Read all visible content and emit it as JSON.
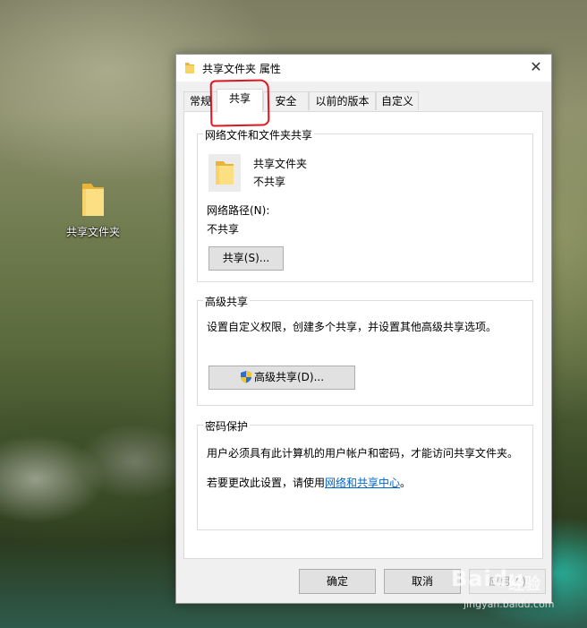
{
  "desktop": {
    "icon_label": "共享文件夹"
  },
  "dialog": {
    "title": "共享文件夹 属性",
    "close_glyph": "✕",
    "tabs": [
      {
        "label": "常规",
        "active": false
      },
      {
        "label": "共享",
        "active": true
      },
      {
        "label": "安全",
        "active": false
      },
      {
        "label": "以前的版本",
        "active": false
      },
      {
        "label": "自定义",
        "active": false
      }
    ],
    "network_share": {
      "group_title": "网络文件和文件夹共享",
      "folder_name": "共享文件夹",
      "share_status": "不共享",
      "path_label": "网络路径(N):",
      "path_value": "不共享",
      "share_button": "共享(S)..."
    },
    "advanced_share": {
      "group_title": "高级共享",
      "description": "设置自定义权限，创建多个共享，并设置其他高级共享选项。",
      "button": "高级共享(D)..."
    },
    "password_protect": {
      "group_title": "密码保护",
      "description": "用户必须具有此计算机的用户帐户和密码，才能访问共享文件夹。",
      "change_prefix": "若要更改此设置，请使用",
      "change_link": "网络和共享中心",
      "change_suffix": "。"
    },
    "footer": {
      "ok": "确定",
      "cancel": "取消",
      "apply": "应用(A)"
    }
  },
  "watermark": {
    "brand": "Baidu",
    "sub": "经验",
    "url": "jingyan.baidu.com"
  },
  "colors": {
    "annotation_red": "#e3141e",
    "link_blue": "#0066cc",
    "folder_yellow": "#f7c948"
  }
}
